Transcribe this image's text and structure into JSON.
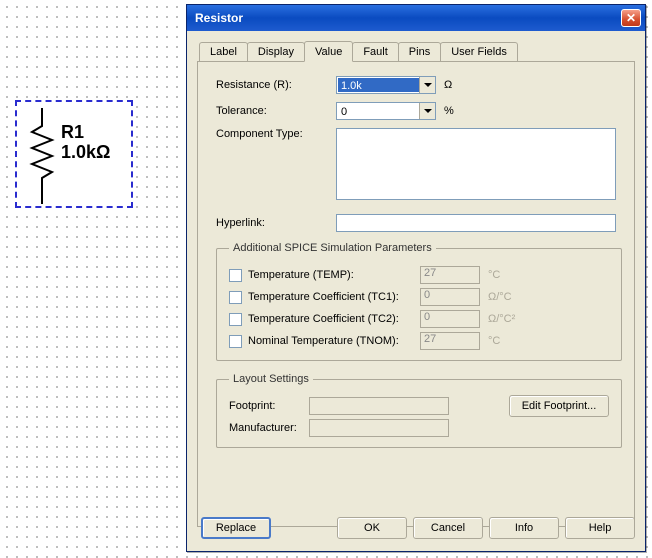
{
  "component": {
    "ref": "R1",
    "value_text": "1.0kΩ"
  },
  "dialog": {
    "title": "Resistor",
    "tabs": [
      "Label",
      "Display",
      "Value",
      "Fault",
      "Pins",
      "User Fields"
    ],
    "active_tab": "Value",
    "value_tab": {
      "resistance_label": "Resistance (R):",
      "resistance_value": "1.0k",
      "resistance_unit": "Ω",
      "tolerance_label": "Tolerance:",
      "tolerance_value": "0",
      "tolerance_unit": "%",
      "component_type_label": "Component Type:",
      "component_type_value": "",
      "hyperlink_label": "Hyperlink:",
      "hyperlink_value": "",
      "spice": {
        "legend": "Additional SPICE Simulation Parameters",
        "rows": [
          {
            "label": "Temperature (TEMP):",
            "value": "27",
            "unit": "°C"
          },
          {
            "label": "Temperature Coefficient (TC1):",
            "value": "0",
            "unit": "Ω/°C"
          },
          {
            "label": "Temperature Coefficient (TC2):",
            "value": "0",
            "unit": "Ω/°C²"
          },
          {
            "label": "Nominal Temperature (TNOM):",
            "value": "27",
            "unit": "°C"
          }
        ]
      },
      "layout": {
        "legend": "Layout Settings",
        "footprint_label": "Footprint:",
        "footprint_value": "",
        "manufacturer_label": "Manufacturer:",
        "manufacturer_value": "",
        "edit_footprint_btn": "Edit Footprint..."
      }
    },
    "buttons": {
      "replace": "Replace",
      "ok": "OK",
      "cancel": "Cancel",
      "info": "Info",
      "help": "Help"
    }
  }
}
